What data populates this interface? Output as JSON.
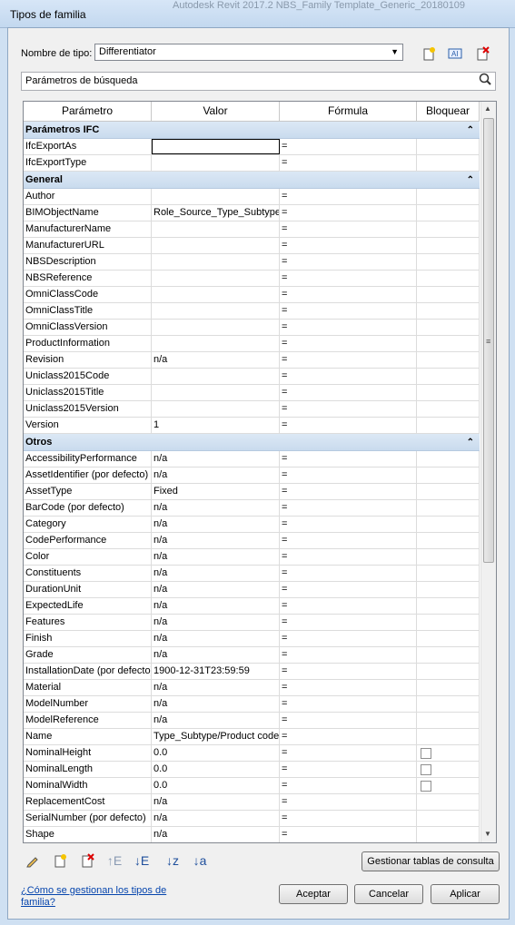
{
  "window": {
    "title": "Tipos de familia",
    "background_title": "Autodesk Revit 2017.2     NBS_Family Template_Generic_20180109"
  },
  "type_selector": {
    "label": "Nombre de tipo:",
    "value": "Differentiator"
  },
  "toolbar_icons": [
    "new-type-icon",
    "rename-type-icon",
    "delete-type-icon"
  ],
  "search": {
    "placeholder": "Parámetros de búsqueda"
  },
  "columns": [
    "Parámetro",
    "Valor",
    "Fórmula",
    "Bloquear"
  ],
  "groups": [
    {
      "name": "Parámetros IFC",
      "rows": [
        {
          "param": "IfcExportAs",
          "value": "",
          "formula": "=",
          "active": true
        },
        {
          "param": "IfcExportType",
          "value": "",
          "formula": "="
        }
      ]
    },
    {
      "name": "General",
      "rows": [
        {
          "param": "Author",
          "value": "",
          "formula": "="
        },
        {
          "param": "BIMObjectName",
          "value": "Role_Source_Type_Subtype",
          "formula": "="
        },
        {
          "param": "ManufacturerName",
          "value": "",
          "formula": "="
        },
        {
          "param": "ManufacturerURL",
          "value": "",
          "formula": "="
        },
        {
          "param": "NBSDescription",
          "value": "",
          "formula": "="
        },
        {
          "param": "NBSReference",
          "value": "",
          "formula": "="
        },
        {
          "param": "OmniClassCode",
          "value": "",
          "formula": "="
        },
        {
          "param": "OmniClassTitle",
          "value": "",
          "formula": "="
        },
        {
          "param": "OmniClassVersion",
          "value": "",
          "formula": "="
        },
        {
          "param": "ProductInformation",
          "value": "",
          "formula": "="
        },
        {
          "param": "Revision",
          "value": "n/a",
          "formula": "="
        },
        {
          "param": "Uniclass2015Code",
          "value": "",
          "formula": "="
        },
        {
          "param": "Uniclass2015Title",
          "value": "",
          "formula": "="
        },
        {
          "param": "Uniclass2015Version",
          "value": "",
          "formula": "="
        },
        {
          "param": "Version",
          "value": "1",
          "formula": "="
        }
      ]
    },
    {
      "name": "Otros",
      "rows": [
        {
          "param": "AccessibilityPerformance",
          "value": "n/a",
          "formula": "="
        },
        {
          "param": "AssetIdentifier (por defecto)",
          "value": "n/a",
          "formula": "="
        },
        {
          "param": "AssetType",
          "value": "Fixed",
          "formula": "="
        },
        {
          "param": "BarCode (por defecto)",
          "value": "n/a",
          "formula": "="
        },
        {
          "param": "Category",
          "value": "n/a",
          "formula": "="
        },
        {
          "param": "CodePerformance",
          "value": "n/a",
          "formula": "="
        },
        {
          "param": "Color",
          "value": "n/a",
          "formula": "="
        },
        {
          "param": "Constituents",
          "value": "n/a",
          "formula": "="
        },
        {
          "param": "DurationUnit",
          "value": "n/a",
          "formula": "="
        },
        {
          "param": "ExpectedLife",
          "value": "n/a",
          "formula": "="
        },
        {
          "param": "Features",
          "value": "n/a",
          "formula": "="
        },
        {
          "param": "Finish",
          "value": "n/a",
          "formula": "="
        },
        {
          "param": "Grade",
          "value": "n/a",
          "formula": "="
        },
        {
          "param": "InstallationDate (por defecto)",
          "value": "1900-12-31T23:59:59",
          "formula": "="
        },
        {
          "param": "Material",
          "value": "n/a",
          "formula": "="
        },
        {
          "param": "ModelNumber",
          "value": "n/a",
          "formula": "="
        },
        {
          "param": "ModelReference",
          "value": "n/a",
          "formula": "="
        },
        {
          "param": "Name",
          "value": "Type_Subtype/Product code",
          "formula": "="
        },
        {
          "param": "NominalHeight",
          "value": "0.0",
          "formula": "=",
          "lock": true
        },
        {
          "param": "NominalLength",
          "value": "0.0",
          "formula": "=",
          "lock": true
        },
        {
          "param": "NominalWidth",
          "value": "0.0",
          "formula": "=",
          "lock": true
        },
        {
          "param": "ReplacementCost",
          "value": "n/a",
          "formula": "="
        },
        {
          "param": "SerialNumber (por defecto)",
          "value": "n/a",
          "formula": "="
        },
        {
          "param": "Shape",
          "value": "n/a",
          "formula": "="
        }
      ]
    }
  ],
  "bottom_icons": [
    "edit-parameter-icon",
    "new-parameter-icon",
    "delete-parameter-icon",
    "move-up-icon",
    "move-down-icon",
    "sort-ascending-icon",
    "sort-descending-icon"
  ],
  "buttons": {
    "lookup": "Gestionar tablas de consulta",
    "ok": "Aceptar",
    "cancel": "Cancelar",
    "apply": "Aplicar"
  },
  "help_link": "¿Cómo se gestionan los tipos de familia?"
}
